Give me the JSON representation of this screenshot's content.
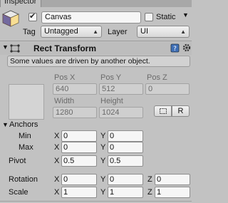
{
  "window": {
    "tab_title": "Inspector"
  },
  "gameobject": {
    "active": true,
    "name": "Canvas",
    "static_label": "Static",
    "static_checked": false,
    "tag_label": "Tag",
    "tag_value": "Untagged",
    "layer_label": "Layer",
    "layer_value": "UI"
  },
  "rect_transform": {
    "title": "Rect Transform",
    "help_text": "Some values are driven by another object.",
    "pos_x_label": "Pos X",
    "pos_y_label": "Pos Y",
    "pos_z_label": "Pos Z",
    "pos_x": "640",
    "pos_y": "512",
    "pos_z": "0",
    "width_label": "Width",
    "height_label": "Height",
    "width": "1280",
    "height": "1024",
    "raw_button_label": "R",
    "anchors_label": "Anchors",
    "min_label": "Min",
    "max_label": "Max",
    "pivot_label": "Pivot",
    "rotation_label": "Rotation",
    "scale_label": "Scale",
    "axis_x": "X",
    "axis_y": "Y",
    "axis_z": "Z",
    "anchor_min": {
      "x": "0",
      "y": "0"
    },
    "anchor_max": {
      "x": "0",
      "y": "0"
    },
    "pivot": {
      "x": "0.5",
      "y": "0.5"
    },
    "rotation": {
      "x": "0",
      "y": "0",
      "z": "0"
    },
    "scale": {
      "x": "1",
      "y": "1",
      "z": "1"
    }
  },
  "icons": {
    "gameobject": "cube-icon",
    "help": "help-book-icon",
    "settings": "gear-icon",
    "fold": "foldout-arrow-icon",
    "blueprint": "blueprint-mode-icon"
  }
}
